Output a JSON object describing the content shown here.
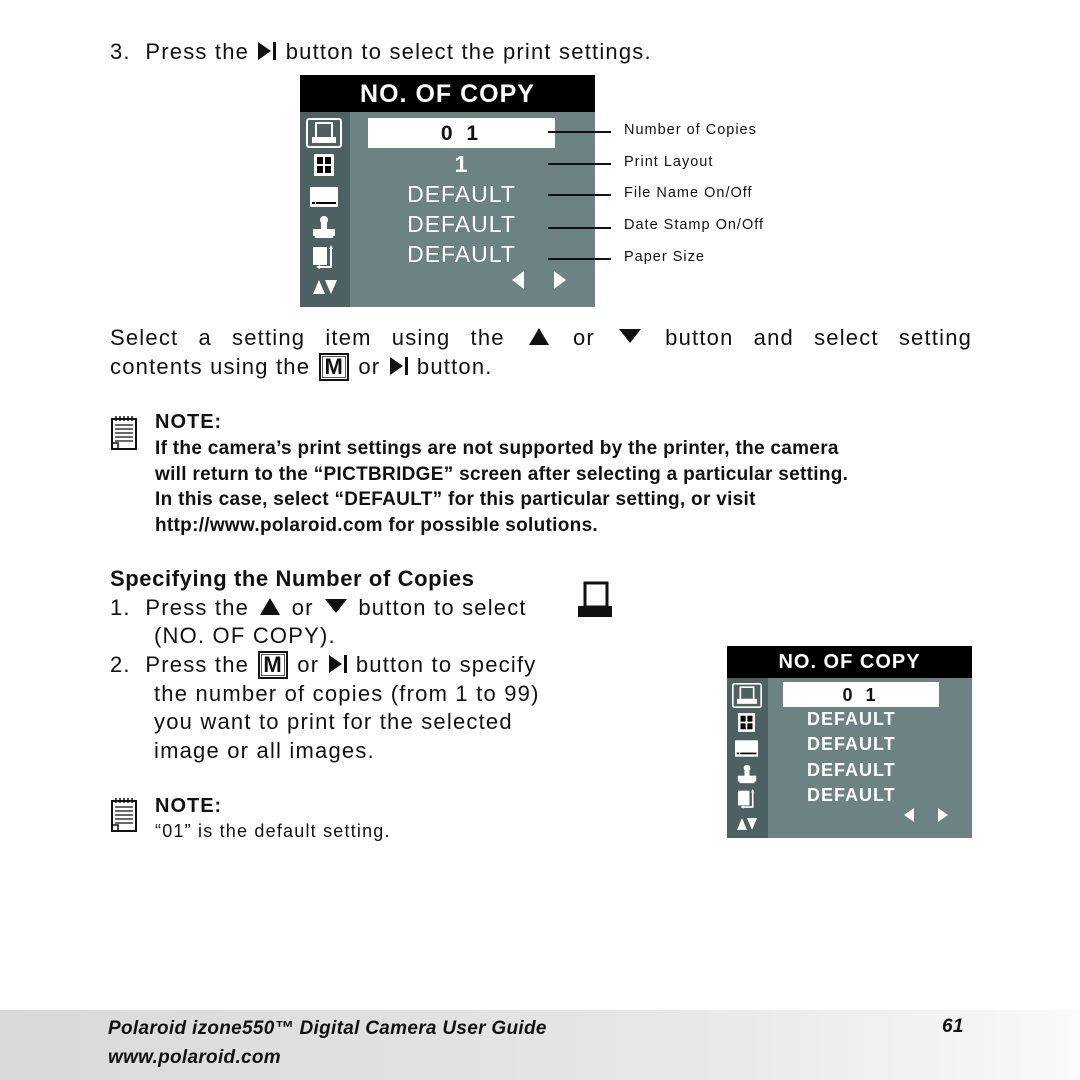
{
  "step3": {
    "num": "3.",
    "before": "Press the",
    "after": "button to select the print settings.",
    "icon": "play-pause-icon"
  },
  "lcd_large": {
    "title": "NO. OF COPY",
    "selected_value": "0 1",
    "values": [
      "1",
      "DEFAULT",
      "DEFAULT",
      "DEFAULT"
    ],
    "side_icons": [
      "printer-copies-icon",
      "print-layout-grid-icon",
      "file-name-bar-icon",
      "date-stamp-icon",
      "paper-size-icon",
      "up-down-arrows-icon"
    ],
    "nav": [
      "left-arrow-icon",
      "right-arrow-icon"
    ],
    "callouts": [
      "Number of Copies",
      "Print Layout",
      "File Name On/Off",
      "Date Stamp On/Off",
      "Paper Size"
    ]
  },
  "instruction": {
    "line1_a": "Select a setting item using the",
    "line1_or": "or",
    "line1_b": "button and select setting",
    "line2_a": "contents using the",
    "m_key": "M",
    "line2_or": "or",
    "line2_b": "button."
  },
  "note1": {
    "title": "NOTE:",
    "lines": [
      "If the camera’s print settings are not supported by the printer, the camera",
      "will return to the “PICTBRIDGE” screen after selecting a particular setting.",
      "In this case, select “DEFAULT” for this particular setting, or visit",
      "http://www.polaroid.com for possible solutions."
    ]
  },
  "section": {
    "heading": "Specifying the Number of Copies",
    "step1": {
      "num": "1.",
      "a": "Press the",
      "or": "or",
      "b": "button to select",
      "line2": "(NO. OF COPY)."
    },
    "step2": {
      "num": "2.",
      "a": "Press the",
      "m_key": "M",
      "or": "or",
      "b": "button to specify",
      "lines": [
        "the number of copies (from 1 to 99)",
        "you want to print for the selected",
        "image or all images."
      ]
    }
  },
  "note2": {
    "title": "NOTE:",
    "text": "“01” is the default setting."
  },
  "lcd_small": {
    "title": "NO. OF COPY",
    "selected_value": "0 1",
    "values": [
      "DEFAULT",
      "DEFAULT",
      "DEFAULT",
      "DEFAULT"
    ]
  },
  "footer": {
    "title": "Polaroid izone550™ Digital Camera User Guide",
    "url": "www.polaroid.com",
    "page": "61"
  }
}
